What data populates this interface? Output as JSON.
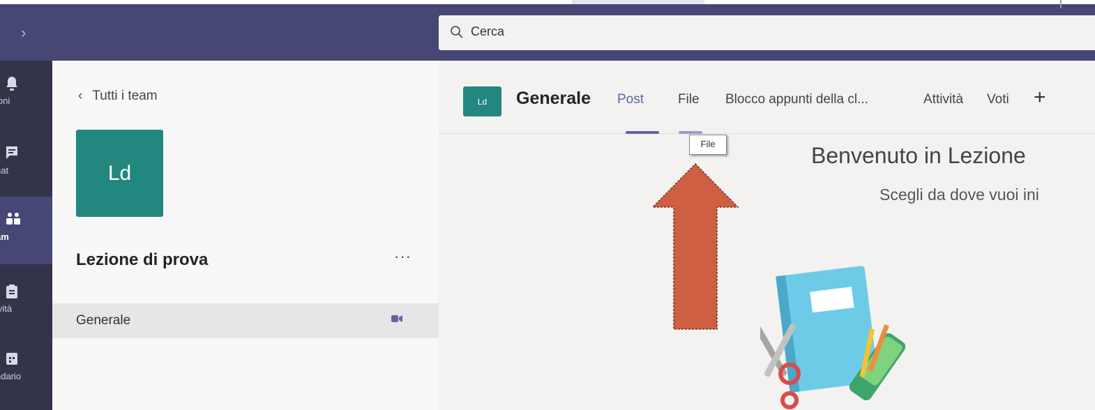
{
  "search": {
    "placeholder": "Cerca"
  },
  "rail": {
    "items": [
      {
        "label": "ioni",
        "icon": "bell-icon"
      },
      {
        "label": "hat",
        "icon": "chat-icon"
      },
      {
        "label": "am",
        "icon": "teams-icon",
        "active": true
      },
      {
        "label": "ività",
        "icon": "assignments-icon"
      },
      {
        "label": "ndario",
        "icon": "calendar-icon"
      }
    ]
  },
  "sidebar": {
    "back_label": "Tutti i team",
    "team_initials": "Ld",
    "team_name": "Lezione di prova",
    "more": "···",
    "channels": [
      {
        "label": "Generale",
        "active": true
      }
    ]
  },
  "channel": {
    "initials": "Ld",
    "title": "Generale",
    "tabs": [
      {
        "label": "Post",
        "active": true
      },
      {
        "label": "File"
      },
      {
        "label": "Blocco appunti della cl..."
      },
      {
        "label": "Attività"
      },
      {
        "label": "Voti"
      }
    ],
    "add_tab": "+"
  },
  "tooltip": {
    "text": "File"
  },
  "content": {
    "welcome": "Benvenuto in Lezione",
    "subtitle": "Scegli da dove vuoi ini"
  },
  "colors": {
    "app_bar": "#464775",
    "rail": "#33344a",
    "accent": "#6264a7",
    "team_avatar": "#22877f",
    "arrow_annotation": "#cf5f42"
  }
}
